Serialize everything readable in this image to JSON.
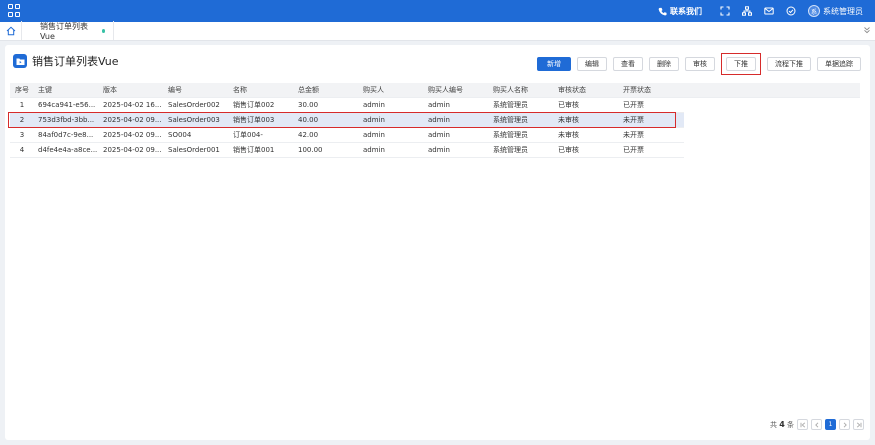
{
  "topbar": {
    "contact_label": "联系我们",
    "user_name": "系统管理员",
    "avatar_text": "系",
    "icons": [
      "apps-grid-icon",
      "phone-icon",
      "fullscreen-icon",
      "network-icon",
      "mail-icon",
      "check-circle-icon"
    ]
  },
  "tabs": {
    "active_label": "销售订单列表Vue"
  },
  "page": {
    "title": "销售订单列表Vue"
  },
  "toolbar": {
    "new_label": "新增",
    "edit_label": "编辑",
    "view_label": "查看",
    "delete_label": "删除",
    "audit_label": "审核",
    "push_label": "下推",
    "flow_push_label": "流程下推",
    "track_label": "单据追踪"
  },
  "table": {
    "headers": [
      "序号",
      "主键",
      "版本",
      "编号",
      "名称",
      "总金额",
      "购买人",
      "购买人编号",
      "购买人名称",
      "审核状态",
      "开票状态"
    ],
    "rows": [
      [
        "1",
        "694ca941-e56...",
        "2025-04-02 16...",
        "SalesOrder002",
        "销售订单002",
        "30.00",
        "admin",
        "admin",
        "系统管理员",
        "已审核",
        "已开票"
      ],
      [
        "2",
        "753d3fbd-3bb...",
        "2025-04-02 09...",
        "SalesOrder003",
        "销售订单003",
        "40.00",
        "admin",
        "admin",
        "系统管理员",
        "未审核",
        "未开票"
      ],
      [
        "3",
        "84af0d7c-9e8...",
        "2025-04-02 09...",
        "SO004",
        "订单004-",
        "42.00",
        "admin",
        "admin",
        "系统管理员",
        "未审核",
        "未开票"
      ],
      [
        "4",
        "d4fe4e4a-a8ce...",
        "2025-04-02 09...",
        "SalesOrder001",
        "销售订单001",
        "100.00",
        "admin",
        "admin",
        "系统管理员",
        "已审核",
        "已开票"
      ]
    ],
    "selected_row": 1
  },
  "pager": {
    "total_prefix": "共",
    "total_count": "4",
    "total_suffix": "条",
    "current_page": "1"
  },
  "colors": {
    "brand": "#1f6bd6",
    "highlight": "#d62b2b",
    "selected_row": "#e2e9f6"
  }
}
